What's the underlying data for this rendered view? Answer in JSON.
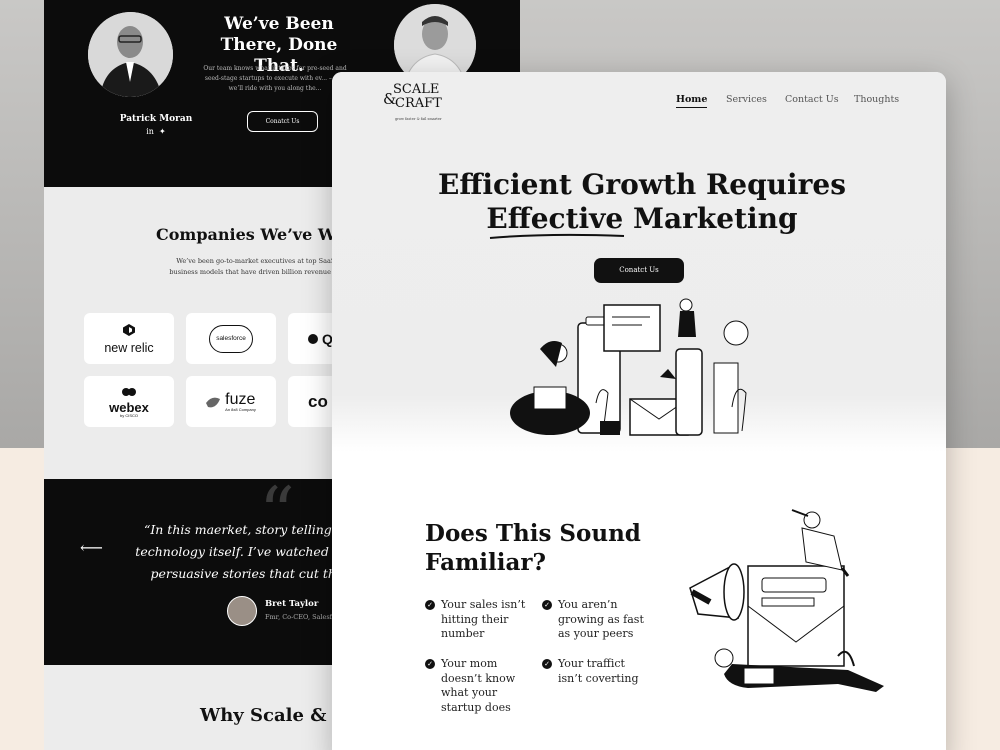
{
  "back_page": {
    "hero": {
      "title": "We’ve Been There, Done That.",
      "copy": "Our team knows what it takes for pre-seed and seed-stage startups to execute with ev... – and we’ll ride with you along the...",
      "person_name": "Patrick Moran",
      "contact_label": "Conatct Us"
    },
    "companies": {
      "title": "Companies We’ve Wor",
      "copy": "We’ve been go-to-market executives at top SaaS with business models that have driven billion revenue growth.",
      "logos": [
        "new relic",
        "salesforce",
        "Q",
        "webex",
        "fuze",
        "co"
      ],
      "logo_subtexts": {
        "webex": "by CISCO",
        "fuze": "An 8x8 Company"
      }
    },
    "testimonial": {
      "quote": "“In this maerket, story telling is as technology itself. I’ve watched this te persuasive stories that cut throu",
      "quote_mark": "“",
      "author": "Bret Taylor",
      "role": "Fmr, Co-CEO, Salesfor"
    },
    "why_title": "Why Scale & C"
  },
  "front_page": {
    "brand": {
      "line1": "SCALE",
      "amp": "&",
      "line2": "CRAFT",
      "tagline": "grow faster & fail smarter"
    },
    "nav": [
      "Home",
      "Services",
      "Contact Us",
      "Thoughts"
    ],
    "active_nav": "Home",
    "hero": {
      "title_line1": "Efficient Growth Requires",
      "title_word_underlined": "Effective",
      "title_line2_rest": "Marketing",
      "cta_label": "Conatct Us"
    },
    "pain_points": {
      "title": "Does This Sound Familiar?",
      "items": [
        "Your sales isn’t hitting their number",
        "You aren’n growing as fast as your peers",
        "Your mom doesn’t know what your startup does",
        "Your traffict isn’t coverting"
      ]
    }
  },
  "colors": {
    "dark": "#0c0c0c",
    "light": "#ededed",
    "accent": "#111111"
  }
}
